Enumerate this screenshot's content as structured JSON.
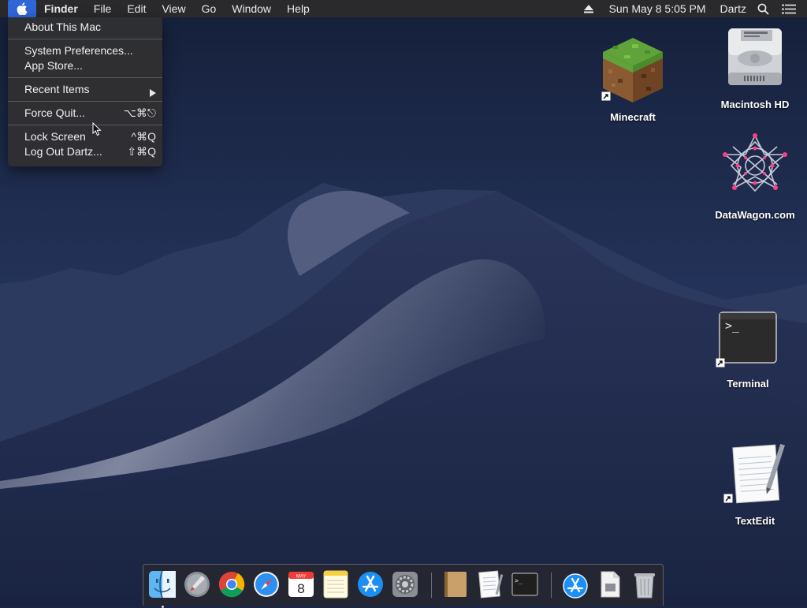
{
  "menubar": {
    "app_name": "Finder",
    "menus": [
      "File",
      "Edit",
      "View",
      "Go",
      "Window",
      "Help"
    ],
    "datetime": "Sun May 8  5:05 PM",
    "user": "Dartz"
  },
  "apple_menu": {
    "items": [
      {
        "label": "About This Mac",
        "shortcut": ""
      },
      {
        "label": "System Preferences...",
        "shortcut": ""
      },
      {
        "label": "App Store...",
        "shortcut": ""
      },
      {
        "label": "Recent Items",
        "shortcut": ""
      },
      {
        "label": "Force Quit...",
        "shortcut": "⌥⌘⎋"
      },
      {
        "label": "Lock Screen",
        "shortcut": "^⌘Q"
      },
      {
        "label": "Log Out Dartz...",
        "shortcut": "⇧⌘Q"
      }
    ]
  },
  "desktop_icons": [
    {
      "label": "Minecraft",
      "icon": "minecraft-icon"
    },
    {
      "label": "Macintosh HD",
      "icon": "hard-drive-icon"
    },
    {
      "label": "DataWagon.com",
      "icon": "datawagon-icon"
    },
    {
      "label": "Terminal",
      "icon": "terminal-icon"
    },
    {
      "label": "TextEdit",
      "icon": "textedit-icon"
    }
  ],
  "dock": {
    "apps": [
      "finder-icon",
      "launchpad-icon",
      "chrome-icon",
      "safari-icon",
      "calendar-icon",
      "notes-icon",
      "app-store-icon",
      "system-preferences-icon",
      "contacts-icon",
      "textedit-icon",
      "terminal-icon",
      "app-store-downloads-icon",
      "document-icon",
      "trash-icon"
    ],
    "calendar_month": "MAY",
    "calendar_day": "8"
  },
  "colors": {
    "menubar": "#2a2a2c",
    "accent": "#2f66d9",
    "sky": "#1b2644"
  }
}
